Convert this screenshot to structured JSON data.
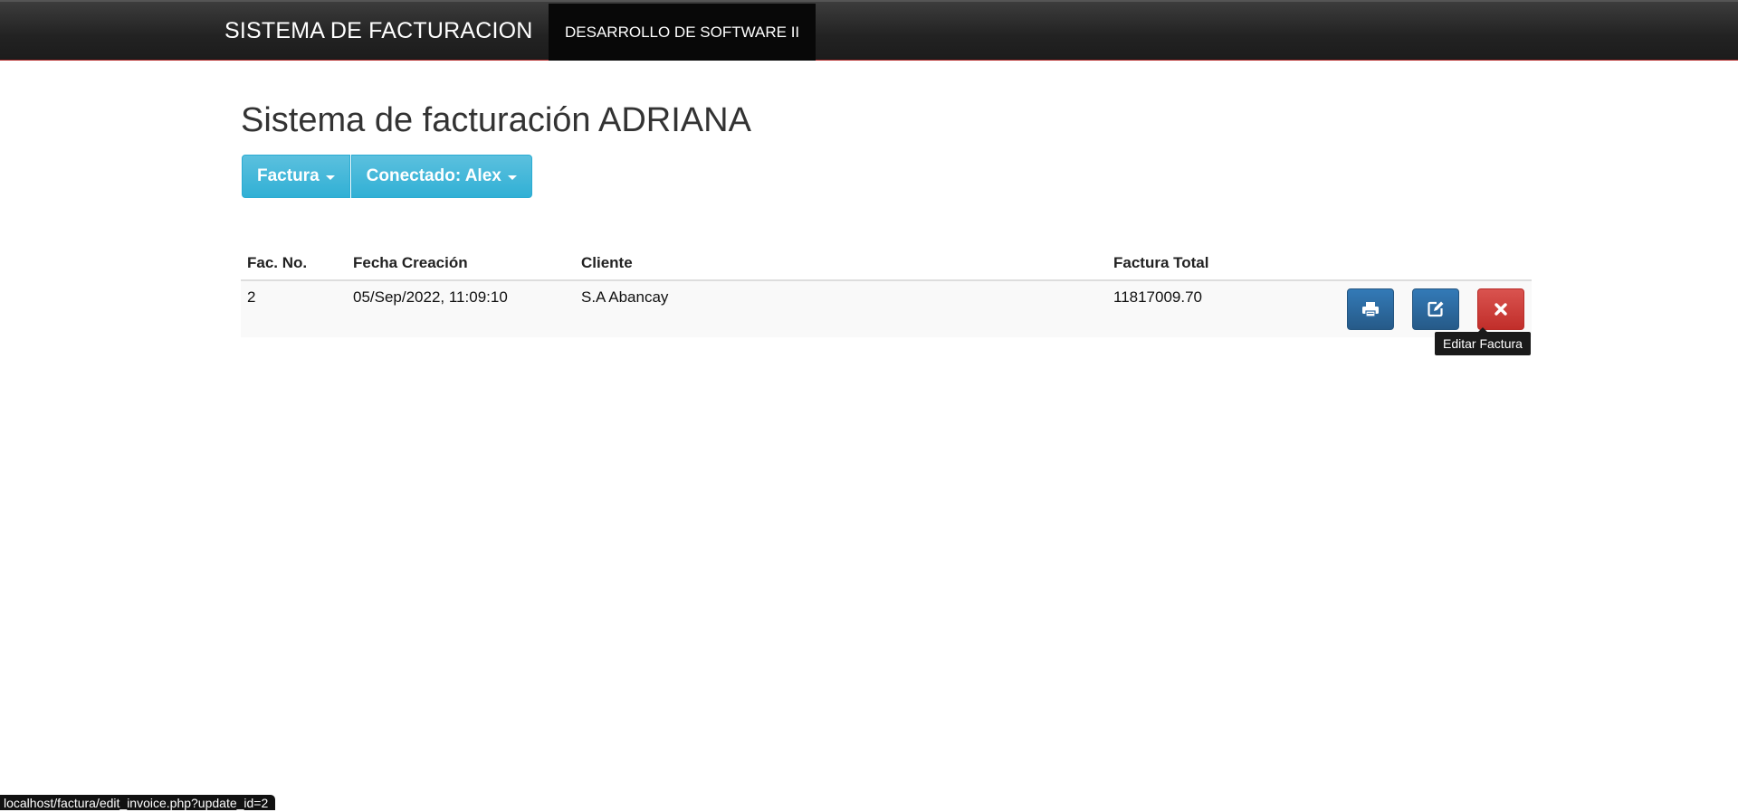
{
  "navbar": {
    "brand": "SISTEMA DE FACTURACION",
    "active_item": "DESARROLLO DE SOFTWARE II"
  },
  "page": {
    "title": "Sistema de facturación ADRIANA"
  },
  "toolbar": {
    "factura_label": "Factura",
    "user_label": "Conectado: Alex"
  },
  "table": {
    "headers": [
      "Fac. No.",
      "Fecha Creación",
      "Cliente",
      "Factura Total"
    ],
    "rows": [
      {
        "number": "2",
        "date": "05/Sep/2022, 11:09:10",
        "client": "S.A Abancay",
        "total": "11817009.70"
      }
    ]
  },
  "tooltip": {
    "text": "Editar Factura"
  },
  "statusbar": {
    "url": "localhost/factura/edit_invoice.php?update_id=2"
  },
  "colors": {
    "info": "#5bc0de",
    "primary": "#337ab7",
    "danger": "#d9534f",
    "navbar": "#222222"
  },
  "icons": {
    "print": "print-icon",
    "edit": "edit-icon",
    "delete": "close-icon"
  }
}
